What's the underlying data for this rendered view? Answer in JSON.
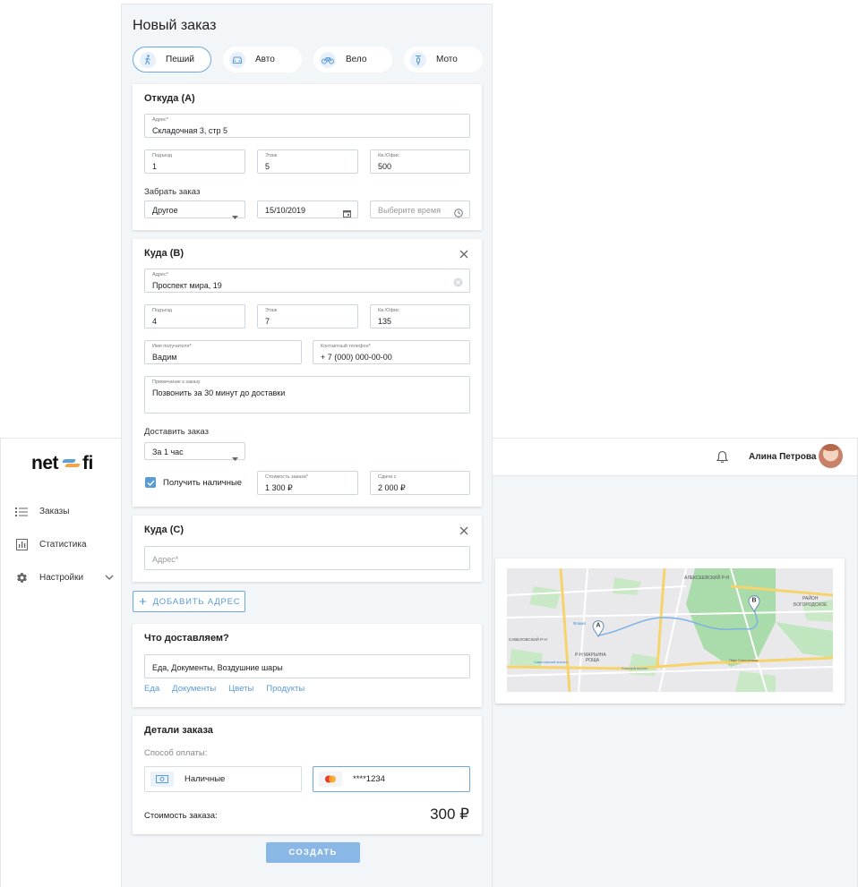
{
  "app": {
    "logo_left": "net",
    "logo_right": "fi",
    "accent_color": "#5a9bd6"
  },
  "sidebar": {
    "items": [
      {
        "label": "Заказы",
        "icon": "list-icon"
      },
      {
        "label": "Статистика",
        "icon": "bar-chart-icon"
      },
      {
        "label": "Настройки",
        "icon": "gear-icon"
      }
    ]
  },
  "topbar": {
    "user_name": "Алина Петрова"
  },
  "map": {
    "labels": [
      "АЛЕКСЕЕВСКИЙ Р-Н",
      "РАЙОН",
      "БОГОРОДСКОЕ",
      "САВЕЛОВСКИЙ Р-Н",
      "Р-Н МАРЬИНА",
      "РОЩА",
      "Фламп",
      "Савеловский вокзал",
      "Рижский вокзал",
      "Парк Сокольники"
    ],
    "pin_a": "A",
    "pin_b": "B"
  },
  "order": {
    "title": "Новый заказ",
    "modes": [
      {
        "label": "Пеший",
        "icon": "walk-icon",
        "active": true
      },
      {
        "label": "Авто",
        "icon": "car-icon",
        "active": false
      },
      {
        "label": "Вело",
        "icon": "bike-icon",
        "active": false
      },
      {
        "label": "Мото",
        "icon": "moto-icon",
        "active": false
      }
    ],
    "from": {
      "title": "Откуда (А)",
      "address_label": "Адрес*",
      "address": "Складочная 3, стр 5",
      "entrance_label": "Подъезд",
      "entrance": "1",
      "floor_label": "Этаж",
      "floor": "5",
      "office_label": "Кв./Офис",
      "office": "500",
      "pickup_label": "Забрать заказ",
      "pickup_option": "Другое",
      "pickup_date": "15/10/2019",
      "pickup_time_placeholder": "Выберите время"
    },
    "to_b": {
      "title": "Куда (В)",
      "address_label": "Адрес*",
      "address": "Проспект мира, 19",
      "entrance_label": "Подъезд",
      "entrance": "4",
      "floor_label": "Этаж",
      "floor": "7",
      "office_label": "Кв./Офис",
      "office": "135",
      "recipient_label": "Имя получателя*",
      "recipient": "Вадим",
      "phone_label": "Контактный телефон*",
      "phone": "+ 7 (000) 000-00-00",
      "note_label": "Примечание к заказу",
      "note": "Позвонить за 30 минут до доставки",
      "deliver_label": "Доставить заказ",
      "deliver_option": "За 1 час",
      "cash_label": "Получить наличные",
      "cash_checked": true,
      "cost_label": "Стоимость заказа*",
      "cost": "1 300 ₽",
      "change_label": "Сдача с",
      "change": "2 000 ₽"
    },
    "to_c": {
      "title": "Куда (С)",
      "address_placeholder": "Адрес*"
    },
    "add_address": "ДОБАВИТЬ АДРЕС",
    "what": {
      "title": "Что доставляем?",
      "value": "Еда, Документы, Воздушние шары",
      "chips": [
        "Еда",
        "Документы",
        "Цветы",
        "Продукты"
      ]
    },
    "details": {
      "title": "Детали заказа",
      "payment_label": "Способ оплаты:",
      "cash_option": "Наличные",
      "card_option": "****1234",
      "total_label": "Стоимость заказа:",
      "total": "300 ₽"
    },
    "create_button": "СОЗДАТЬ"
  }
}
